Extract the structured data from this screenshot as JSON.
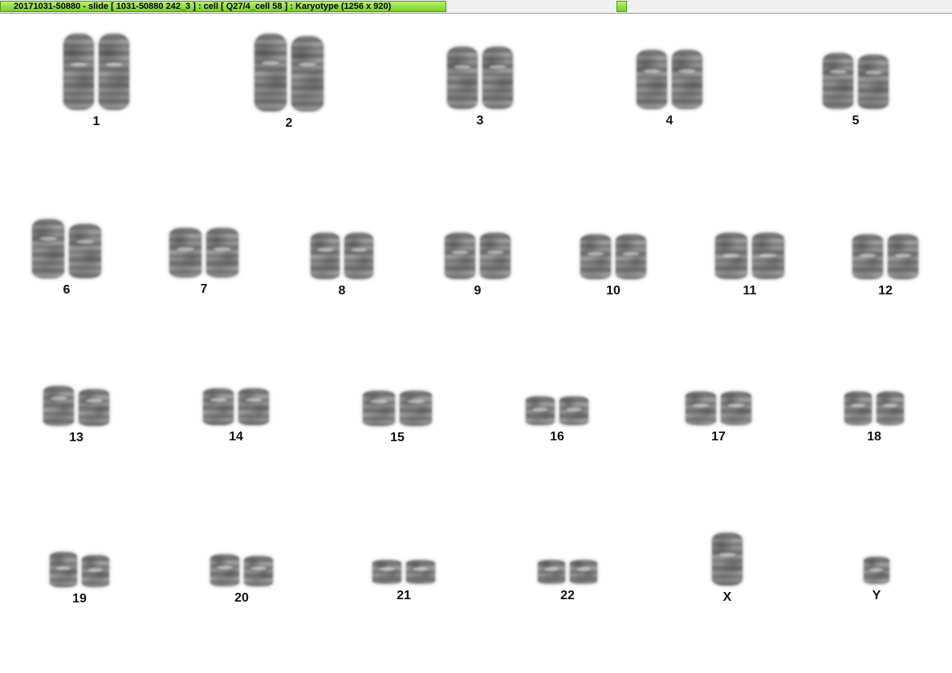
{
  "window": {
    "title": "20171031-50880 - slide [ 1031-50880 242_3 ] : cell [ Q27/4_cell 58 ] : Karyotype  (1256 x 920)"
  },
  "karyotype": {
    "pairs": [
      {
        "label": "1"
      },
      {
        "label": "2"
      },
      {
        "label": "3"
      },
      {
        "label": "4"
      },
      {
        "label": "5"
      },
      {
        "label": "6"
      },
      {
        "label": "7"
      },
      {
        "label": "8"
      },
      {
        "label": "9"
      },
      {
        "label": "10"
      },
      {
        "label": "11"
      },
      {
        "label": "12"
      },
      {
        "label": "13"
      },
      {
        "label": "14"
      },
      {
        "label": "15"
      },
      {
        "label": "16"
      },
      {
        "label": "17"
      },
      {
        "label": "18"
      },
      {
        "label": "19"
      },
      {
        "label": "20"
      },
      {
        "label": "21"
      },
      {
        "label": "22"
      },
      {
        "label": "X"
      },
      {
        "label": "Y"
      }
    ]
  }
}
